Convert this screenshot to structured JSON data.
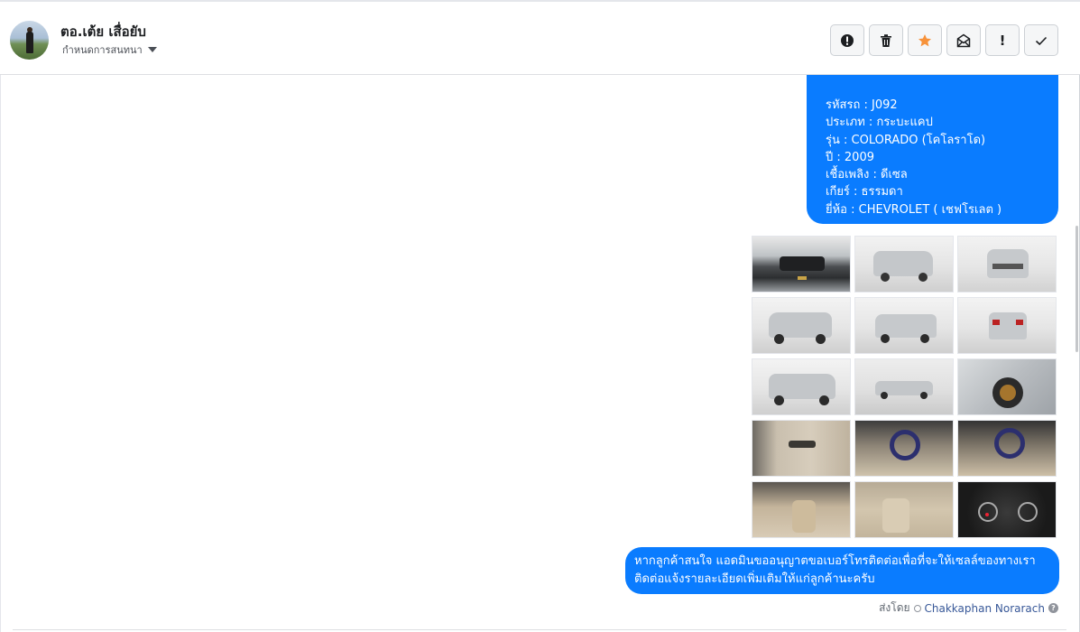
{
  "conversation": {
    "contact_name": "ตอ.เต้ย เสื่อยับ",
    "assign_label": "กำหนดการสนทนา"
  },
  "toolbar": {
    "icons": [
      "alert-circle-icon",
      "trash-icon",
      "star-icon",
      "mark-unread-icon",
      "important-icon",
      "check-icon"
    ],
    "important_glyph": "!",
    "star_color": "#f7923a"
  },
  "message_details": {
    "lines": [
      "รหัสรถ : J092",
      "ประเภท : กระบะแคป",
      "รุ่น : COLORADO (โคโลราโด)",
      "ปี : 2009",
      "เชื้อเพลิง : ดีเซล",
      "เกียร์ : ธรรมดา",
      "ยี่ห้อ : CHEVROLET ( เชฟโรเลต )"
    ]
  },
  "photos": {
    "count": 15,
    "items": [
      "engine-bay",
      "front-three-quarter",
      "front",
      "front-left",
      "rear-three-quarter",
      "rear",
      "rear-left",
      "side-profile",
      "wheel-closeup",
      "door-panel",
      "steering-wheel",
      "dashboard",
      "front-seats",
      "rear-seats",
      "gauge-cluster"
    ]
  },
  "message_footer": {
    "line1": "หากลูกค้าสนใจ แอดมินขออนุญาตขอเบอร์โทรติดต่อเพื่อที่จะให้เซลล์ของทางเรา",
    "line2": "ติดต่อแจ้งรายละเอียดเพิ่มเติมให้แก่ลูกค้านะครับ"
  },
  "sent_by": {
    "prefix": "ส่งโดย",
    "agent": "Chakkaphan Norarach",
    "help_glyph": "?"
  },
  "colors": {
    "bubble": "#0a7cff",
    "border": "#dddfe2"
  }
}
